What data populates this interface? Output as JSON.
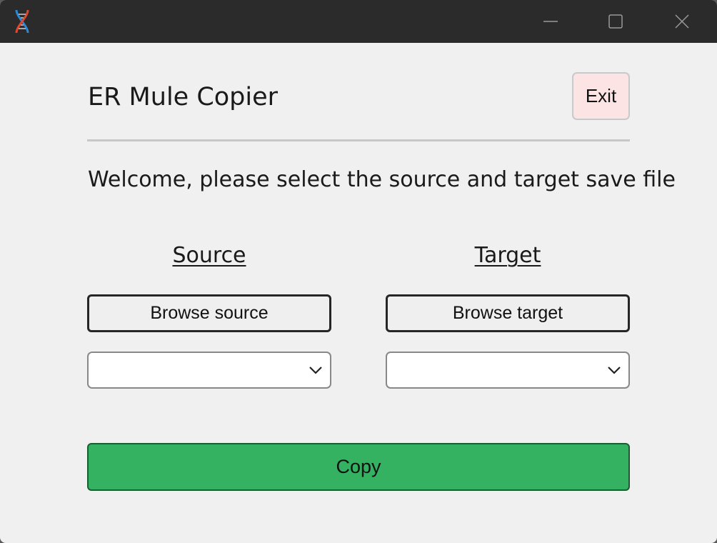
{
  "window": {
    "title_bar": {
      "icon": "dna-helix-icon",
      "controls": [
        "minimize-icon",
        "maximize-icon",
        "close-icon"
      ]
    }
  },
  "header": {
    "title": "ER Mule Copier",
    "exit_label": "Exit"
  },
  "main": {
    "welcome_text": "Welcome, please select the source and target save file",
    "source": {
      "heading": "Source",
      "browse_label": "Browse source",
      "selected": ""
    },
    "target": {
      "heading": "Target",
      "browse_label": "Browse target",
      "selected": ""
    },
    "copy_label": "Copy"
  },
  "colors": {
    "titlebar": "#2b2b2b",
    "background": "#f0f0f0",
    "exit_button": "#fde4e4",
    "copy_button": "#34b262"
  }
}
